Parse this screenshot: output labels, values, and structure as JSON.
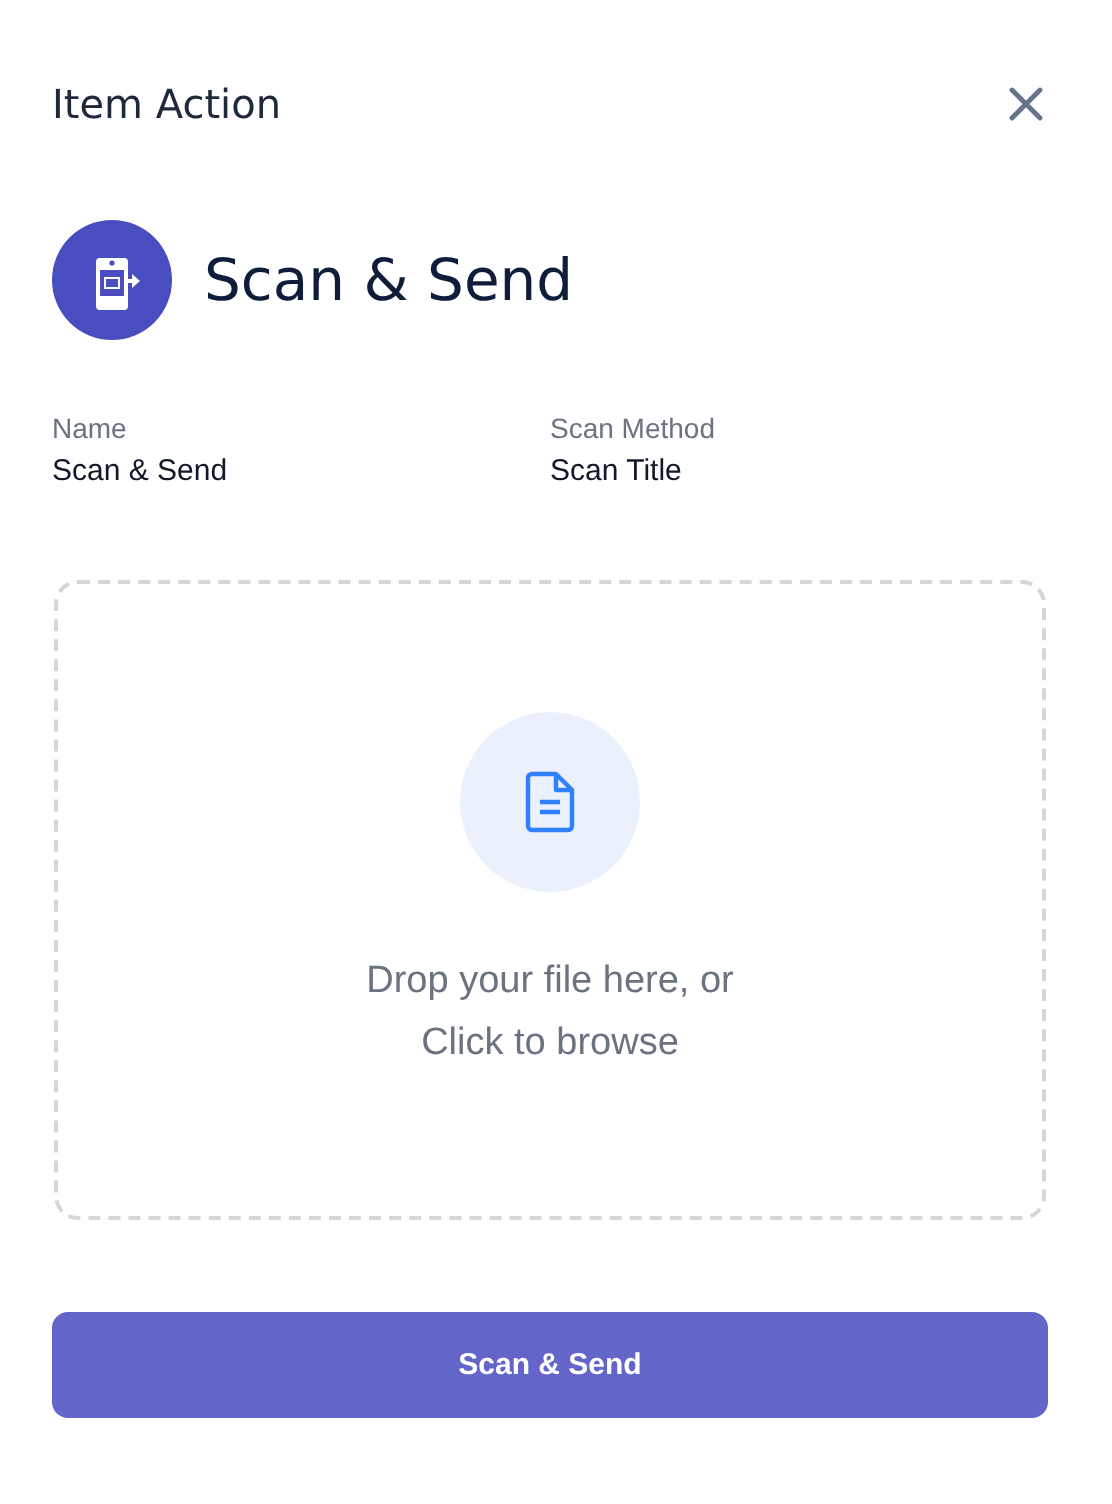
{
  "dialog": {
    "title": "Item Action"
  },
  "action": {
    "name": "Scan & Send"
  },
  "fields": [
    {
      "label": "Name",
      "value": "Scan & Send"
    },
    {
      "label": "Scan Method",
      "value": "Scan Title"
    }
  ],
  "dropzone": {
    "lines": [
      "Drop your file here, or",
      "Click to browse"
    ]
  },
  "primary_button": {
    "label": "Scan & Send"
  }
}
